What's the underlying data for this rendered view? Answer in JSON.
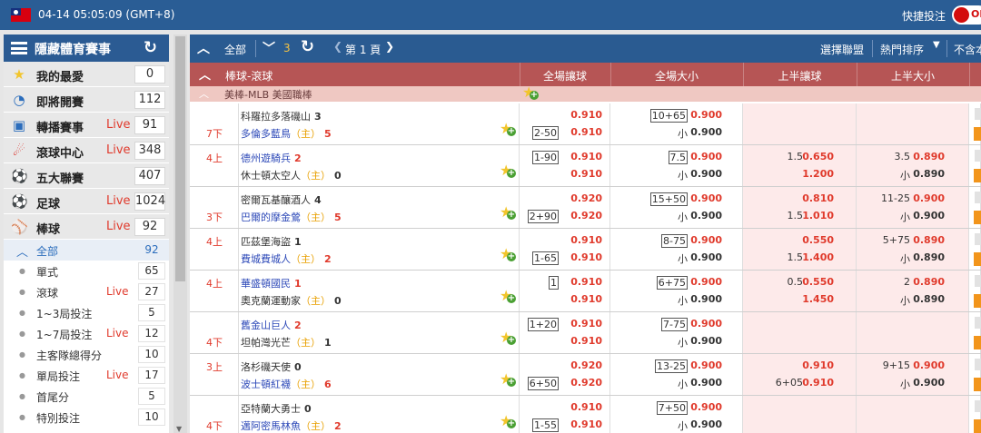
{
  "topbar": {
    "datetime": "04-14 05:05:09 (GMT+8)",
    "quickbet_label": "快捷投注",
    "toggle_text": "OF"
  },
  "sidebar": {
    "title": "隱藏體育賽事",
    "items": [
      {
        "label": "我的最愛",
        "live": "",
        "count": "0",
        "icon": "star-icon"
      },
      {
        "label": "即將開賽",
        "live": "",
        "count": "112",
        "icon": "clock-icon"
      },
      {
        "label": "轉播賽事",
        "live": "Live",
        "count": "91",
        "icon": "tv-icon"
      },
      {
        "label": "滾球中心",
        "live": "Live",
        "count": "348",
        "icon": "runner-icon"
      },
      {
        "label": "五大聯賽",
        "live": "",
        "count": "407",
        "icon": "soccer-ball-icon"
      },
      {
        "label": "足球",
        "live": "Live",
        "count": "1024",
        "icon": "soccer-ball-icon"
      },
      {
        "label": "棒球",
        "live": "Live",
        "count": "92",
        "icon": "baseball-icon"
      }
    ],
    "subitems": [
      {
        "label": "全部",
        "live": "",
        "count": "92",
        "active": true
      },
      {
        "label": "單式",
        "live": "",
        "count": "65"
      },
      {
        "label": "滾球",
        "live": "Live",
        "count": "27"
      },
      {
        "label": "1~3局投注",
        "live": "",
        "count": "5"
      },
      {
        "label": "1~7局投注",
        "live": "Live",
        "count": "12"
      },
      {
        "label": "主客隊總得分",
        "live": "",
        "count": "10"
      },
      {
        "label": "單局投注",
        "live": "Live",
        "count": "17"
      },
      {
        "label": "首尾分",
        "live": "",
        "count": "5"
      },
      {
        "label": "特別投注",
        "live": "",
        "count": "10"
      }
    ]
  },
  "toolbar": {
    "all_label": "全部",
    "count": "3",
    "page_label": "第 1 頁",
    "select_league": "選擇聯盟",
    "sort_label": "熱門排序",
    "no_count_label": "不含本"
  },
  "columns": {
    "sport": "棒球-滾球",
    "hdp": "全場讓球",
    "ou": "全場大小",
    "h1": "上半讓球",
    "h1ou": "上半大小"
  },
  "league": "美棒-MLB 美國職棒",
  "home_tag": "（主）",
  "matches": [
    {
      "time": "7下",
      "team1": "科羅拉多落磯山",
      "team1_color": "dark",
      "score1": "3",
      "team2": "多倫多藍鳥",
      "team2_color": "home",
      "score2": "5",
      "score2_red": true,
      "home": 2,
      "hdp_l1": "",
      "hdp_o1": "0.910",
      "hdp_l2": "2-50",
      "hdp_o2": "0.910",
      "ou_l1": "10+65",
      "ou_o1": "0.900",
      "ou_l2": "小",
      "ou_o2": "0.900",
      "h1_l1": "",
      "h1_o1": "",
      "h1_l2": "",
      "h1_o2": "",
      "h1ou_l1": "",
      "h1ou_o1": "",
      "h1ou_l2": "",
      "h1ou_o2": ""
    },
    {
      "time": "4上",
      "team1": "德州遊騎兵",
      "team1_color": "home",
      "score1": "2",
      "score1_red": true,
      "team2": "休士頓太空人",
      "team2_color": "dark",
      "score2": "0",
      "home": 2,
      "hdp_l1": "1-90",
      "hdp_o1": "0.910",
      "hdp_l2": "",
      "hdp_o2": "0.910",
      "ou_l1": "7.5",
      "ou_o1": "0.900",
      "ou_l2": "小",
      "ou_o2": "0.900",
      "h1_l1": "1.5",
      "h1_o1": "0.650",
      "h1_l2": "",
      "h1_o2": "1.200",
      "h1ou_l1": "3.5",
      "h1ou_o1": "0.890",
      "h1ou_l2": "小",
      "h1ou_o2": "0.890"
    },
    {
      "time": "3下",
      "team1": "密爾瓦基釀酒人",
      "team1_color": "dark",
      "score1": "4",
      "team2": "巴爾的摩金鶯",
      "team2_color": "home",
      "score2": "5",
      "score2_red": true,
      "home": 2,
      "hdp_l1": "",
      "hdp_o1": "0.920",
      "hdp_l2": "2+90",
      "hdp_o2": "0.920",
      "ou_l1": "15+50",
      "ou_o1": "0.900",
      "ou_l2": "小",
      "ou_o2": "0.900",
      "h1_l1": "",
      "h1_o1": "0.810",
      "h1_l2": "1.5",
      "h1_o2": "1.010",
      "h1ou_l1": "11-25",
      "h1ou_o1": "0.900",
      "h1ou_l2": "小",
      "h1ou_o2": "0.900"
    },
    {
      "time": "4上",
      "team1": "匹茲堡海盜",
      "team1_color": "dark",
      "score1": "1",
      "team2": "費城費城人",
      "team2_color": "home",
      "score2": "2",
      "score2_red": true,
      "home": 2,
      "hdp_l1": "",
      "hdp_o1": "0.910",
      "hdp_l2": "1-65",
      "hdp_o2": "0.910",
      "ou_l1": "8-75",
      "ou_o1": "0.900",
      "ou_l2": "小",
      "ou_o2": "0.900",
      "h1_l1": "",
      "h1_o1": "0.550",
      "h1_l2": "1.5",
      "h1_o2": "1.400",
      "h1ou_l1": "5+75",
      "h1ou_o1": "0.890",
      "h1ou_l2": "小",
      "h1ou_o2": "0.890"
    },
    {
      "time": "4上",
      "team1": "華盛頓國民",
      "team1_color": "home",
      "score1": "1",
      "score1_red": true,
      "team2": "奧克蘭運動家",
      "team2_color": "dark",
      "score2": "0",
      "home": 2,
      "hdp_l1": "1",
      "hdp_o1": "0.910",
      "hdp_l2": "",
      "hdp_o2": "0.910",
      "ou_l1": "6+75",
      "ou_o1": "0.900",
      "ou_l2": "小",
      "ou_o2": "0.900",
      "h1_l1": "0.5",
      "h1_o1": "0.550",
      "h1_l2": "",
      "h1_o2": "1.450",
      "h1ou_l1": "2",
      "h1ou_o1": "0.890",
      "h1ou_l2": "小",
      "h1ou_o2": "0.890"
    },
    {
      "time": "4下",
      "team1": "舊金山巨人",
      "team1_color": "home",
      "score1": "2",
      "score1_red": true,
      "team2": "坦帕灣光芒",
      "team2_color": "dark",
      "score2": "1",
      "home": 2,
      "hdp_l1": "1+20",
      "hdp_o1": "0.910",
      "hdp_l2": "",
      "hdp_o2": "0.910",
      "ou_l1": "7-75",
      "ou_o1": "0.900",
      "ou_l2": "小",
      "ou_o2": "0.900",
      "h1_l1": "",
      "h1_o1": "",
      "h1_l2": "",
      "h1_o2": "",
      "h1ou_l1": "",
      "h1ou_o1": "",
      "h1ou_l2": "",
      "h1ou_o2": ""
    },
    {
      "time": "3上",
      "team1": "洛杉磯天使",
      "team1_color": "dark",
      "score1": "0",
      "team2": "波士頓紅襪",
      "team2_color": "home",
      "score2": "6",
      "score2_red": true,
      "home": 2,
      "hdp_l1": "",
      "hdp_o1": "0.920",
      "hdp_l2": "6+50",
      "hdp_o2": "0.920",
      "ou_l1": "13-25",
      "ou_o1": "0.900",
      "ou_l2": "小",
      "ou_o2": "0.900",
      "h1_l1": "",
      "h1_o1": "0.910",
      "h1_l2": "6+05",
      "h1_o2": "0.910",
      "h1ou_l1": "9+15",
      "h1ou_o1": "0.900",
      "h1ou_l2": "小",
      "h1ou_o2": "0.900"
    },
    {
      "time": "4下",
      "team1": "亞特蘭大勇士",
      "team1_color": "dark",
      "score1": "0",
      "team2": "邁阿密馬林魚",
      "team2_color": "home",
      "score2": "2",
      "score2_red": true,
      "home": 2,
      "hdp_l1": "",
      "hdp_o1": "0.910",
      "hdp_l2": "1-55",
      "hdp_o2": "0.910",
      "ou_l1": "7+50",
      "ou_o1": "0.900",
      "ou_l2": "小",
      "ou_o2": "0.900",
      "h1_l1": "",
      "h1_o1": "",
      "h1_l2": "",
      "h1_o2": "",
      "h1ou_l1": "",
      "h1ou_o1": "",
      "h1ou_l2": "",
      "h1ou_o2": ""
    }
  ]
}
